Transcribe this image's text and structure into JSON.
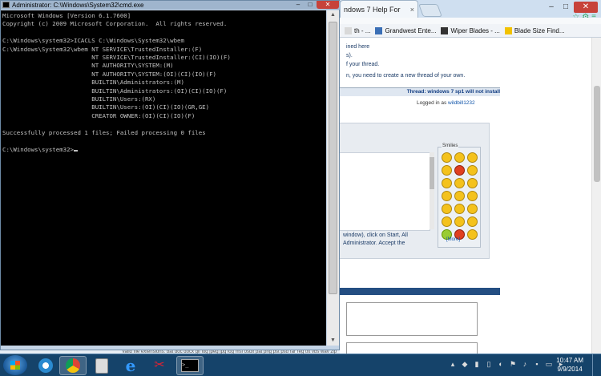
{
  "browser": {
    "tab_title": "ndows 7 Help For",
    "tab_close": "×",
    "window_controls": {
      "minimize": "–",
      "maximize": "□",
      "close": "✕"
    },
    "bookmarks": [
      {
        "label": "th - ...",
        "icon": "page-icon",
        "color": "#d9d9d9"
      },
      {
        "label": "Grandwest Ente...",
        "icon": "page-icon",
        "color": "#3b6fb6"
      },
      {
        "label": "Wiper Blades - ...",
        "icon": "page-icon",
        "color": "#333333"
      },
      {
        "label": "Blade Size Find...",
        "icon": "page-icon",
        "color": "#f2c200"
      }
    ],
    "notice_lines": [
      "ined here",
      "s).",
      "f your thread."
    ],
    "notice_link": "here",
    "message": "n, you need to create a new thread of your own.",
    "thread_label": "Thread: windows 7 sp1 will not install",
    "logged_in_prefix": "Logged in as",
    "logged_in_user": "wildbill1232",
    "smilies_label": "Smilies",
    "smilies_more": "[More]",
    "hint_line1": "window), click on Start, All",
    "hint_line2": "Administrator. Accept the",
    "extensions_line": "Valid file extensions: bat doc docx gif log jpeg jpg log msi osdx pat png pst psd rar reg txt vbs wav zip"
  },
  "cmd": {
    "title": "Administrator: C:\\Windows\\System32\\cmd.exe",
    "controls": {
      "minimize": "–",
      "maximize": "□",
      "close": "✕"
    },
    "lines": [
      "Microsoft Windows [Version 6.1.7600]",
      "Copyright (c) 2009 Microsoft Corporation.  All rights reserved.",
      "",
      "C:\\Windows\\system32>ICACLS C:\\Windows\\System32\\wbem",
      "C:\\Windows\\System32\\wbem NT SERVICE\\TrustedInstaller:(F)",
      "                         NT SERVICE\\TrustedInstaller:(CI)(IO)(F)",
      "                         NT AUTHORITY\\SYSTEM:(M)",
      "                         NT AUTHORITY\\SYSTEM:(OI)(CI)(IO)(F)",
      "                         BUILTIN\\Administrators:(M)",
      "                         BUILTIN\\Administrators:(OI)(CI)(IO)(F)",
      "                         BUILTIN\\Users:(RX)",
      "                         BUILTIN\\Users:(OI)(CI)(IO)(GR,GE)",
      "                         CREATOR OWNER:(OI)(CI)(IO)(F)",
      "",
      "Successfully processed 1 files; Failed processing 0 files",
      "",
      "C:\\Windows\\system32>"
    ]
  },
  "taskbar": {
    "items": [
      {
        "name": "start-button",
        "icon": "windows-logo-icon"
      },
      {
        "name": "ccleaner",
        "icon": "ccleaner-icon",
        "color": "#2a8ad0"
      },
      {
        "name": "chrome",
        "icon": "chrome-icon",
        "color": "#e8b400"
      },
      {
        "name": "calculator",
        "icon": "calculator-icon",
        "color": "#cccccc"
      },
      {
        "name": "internet-explorer",
        "icon": "ie-icon",
        "color": "#3399ff"
      },
      {
        "name": "snipping-tool",
        "icon": "snipping-tool-icon",
        "color": "#cc3322"
      },
      {
        "name": "cmd",
        "icon": "cmd-icon",
        "color": "#000000"
      }
    ],
    "tray_icons": [
      "notification-icon",
      "shield-icon",
      "network-icon",
      "battery-icon",
      "volume-icon",
      "flag-icon",
      "speaker-icon",
      "power-icon",
      "display-icon",
      "usb-icon"
    ],
    "time": "10:47 AM",
    "date": "9/9/2014"
  }
}
